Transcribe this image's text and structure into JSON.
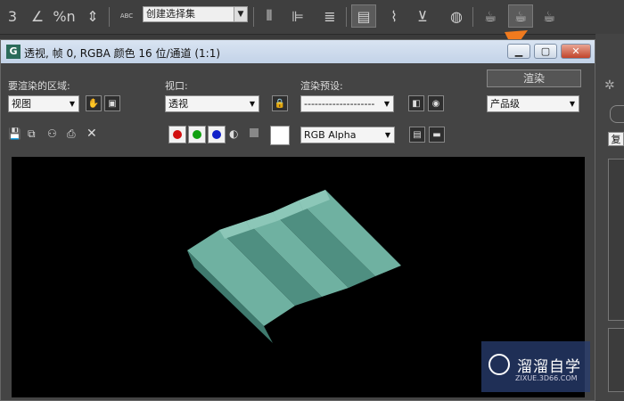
{
  "toolbar": {
    "selection_set": "创建选择集",
    "abc_label": "ABC",
    "snap_label": "3",
    "percent_label": "%n"
  },
  "window": {
    "title": "透视, 帧 0, RGBA 颜色 16 位/通道 (1:1)",
    "logo": "G"
  },
  "controls": {
    "area_label": "要渲染的区域:",
    "area_value": "视图",
    "viewport_label": "视口:",
    "viewport_value": "透视",
    "preset_label": "渲染预设:",
    "preset_value": "--------------------",
    "render_button": "渲染",
    "quality_value": "产品级",
    "channel_value": "RGB Alpha"
  },
  "right_panel": {
    "label_copy": "复"
  },
  "watermark": {
    "main": "溜溜自学",
    "sub": "ZIXUE.3D66.COM"
  },
  "colors": {
    "arrow": "#f07a1e",
    "stairs": "#5f9e8f",
    "red": "#d21010",
    "green": "#10a010",
    "blue": "#1020c8"
  }
}
